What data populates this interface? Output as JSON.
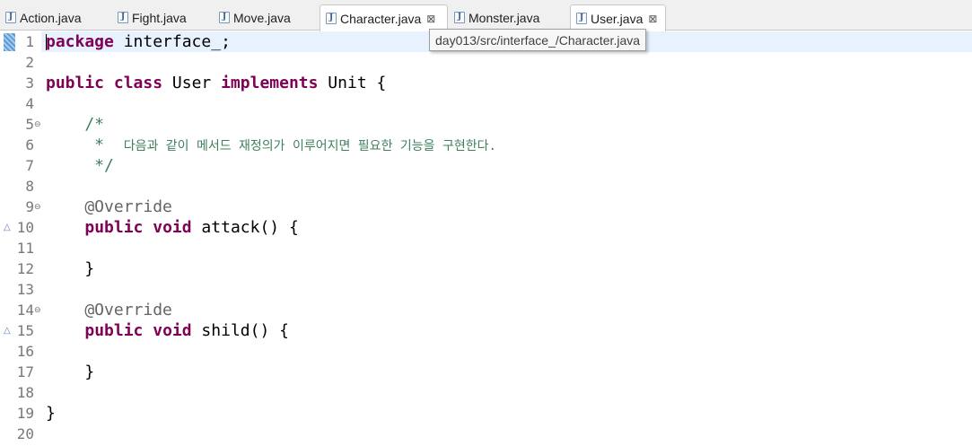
{
  "tabs": [
    {
      "label": "Action.java",
      "active": false,
      "closable": false
    },
    {
      "label": "Fight.java",
      "active": false,
      "closable": false
    },
    {
      "label": "Move.java",
      "active": false,
      "closable": false
    },
    {
      "label": "Character.java",
      "active": true,
      "closable": true
    },
    {
      "label": "Monster.java",
      "active": false,
      "closable": false
    },
    {
      "label": "User.java",
      "active": true,
      "closable": true
    }
  ],
  "tab_icon": "java-file-icon",
  "tab_close_icon": "close-icon",
  "tab_close_glyph": "⊠",
  "tooltip": {
    "text": "day013/src/interface_/Character.java"
  },
  "editor": {
    "lines": [
      {
        "num": "1",
        "parts": [
          {
            "t": "package",
            "c": "kw"
          },
          {
            "t": " interface_;",
            "c": ""
          }
        ]
      },
      {
        "num": "2",
        "parts": []
      },
      {
        "num": "3",
        "parts": [
          {
            "t": "public",
            "c": "kw"
          },
          {
            "t": " ",
            "c": ""
          },
          {
            "t": "class",
            "c": "kw"
          },
          {
            "t": " User ",
            "c": ""
          },
          {
            "t": "implements",
            "c": "kw"
          },
          {
            "t": " Unit {",
            "c": ""
          }
        ]
      },
      {
        "num": "4",
        "parts": []
      },
      {
        "num": "5",
        "fold": true,
        "parts": [
          {
            "t": "    /*",
            "c": "comment"
          }
        ]
      },
      {
        "num": "6",
        "parts": [
          {
            "t": "     *  ",
            "c": "comment"
          },
          {
            "t": "다음과 같이 메서드 재정의가 이루어지면 필요한 기능을 구현한다.",
            "c": "comment comment-ko"
          }
        ]
      },
      {
        "num": "7",
        "parts": [
          {
            "t": "     */",
            "c": "comment"
          }
        ]
      },
      {
        "num": "8",
        "parts": []
      },
      {
        "num": "9",
        "fold": true,
        "parts": [
          {
            "t": "    @Override",
            "c": "annotation"
          }
        ]
      },
      {
        "num": "10",
        "override": true,
        "parts": [
          {
            "t": "    ",
            "c": ""
          },
          {
            "t": "public",
            "c": "kw"
          },
          {
            "t": " ",
            "c": ""
          },
          {
            "t": "void",
            "c": "kw"
          },
          {
            "t": " attack() {",
            "c": ""
          }
        ]
      },
      {
        "num": "11",
        "parts": []
      },
      {
        "num": "12",
        "parts": [
          {
            "t": "    }",
            "c": ""
          }
        ]
      },
      {
        "num": "13",
        "parts": []
      },
      {
        "num": "14",
        "fold": true,
        "parts": [
          {
            "t": "    @Override",
            "c": "annotation"
          }
        ]
      },
      {
        "num": "15",
        "override": true,
        "parts": [
          {
            "t": "    ",
            "c": ""
          },
          {
            "t": "public",
            "c": "kw"
          },
          {
            "t": " ",
            "c": ""
          },
          {
            "t": "void",
            "c": "kw"
          },
          {
            "t": " shild() {",
            "c": ""
          }
        ]
      },
      {
        "num": "16",
        "parts": []
      },
      {
        "num": "17",
        "parts": [
          {
            "t": "    }",
            "c": ""
          }
        ]
      },
      {
        "num": "18",
        "parts": []
      },
      {
        "num": "19",
        "parts": [
          {
            "t": "}",
            "c": ""
          }
        ]
      },
      {
        "num": "20",
        "parts": []
      }
    ]
  },
  "colors": {
    "keyword": "#7f0055",
    "comment": "#3f7f5f",
    "annotation": "#646464",
    "line_number": "#787878",
    "current_line": "#e8f2fe"
  },
  "fold_glyph": "⊖",
  "override_glyph": "△"
}
